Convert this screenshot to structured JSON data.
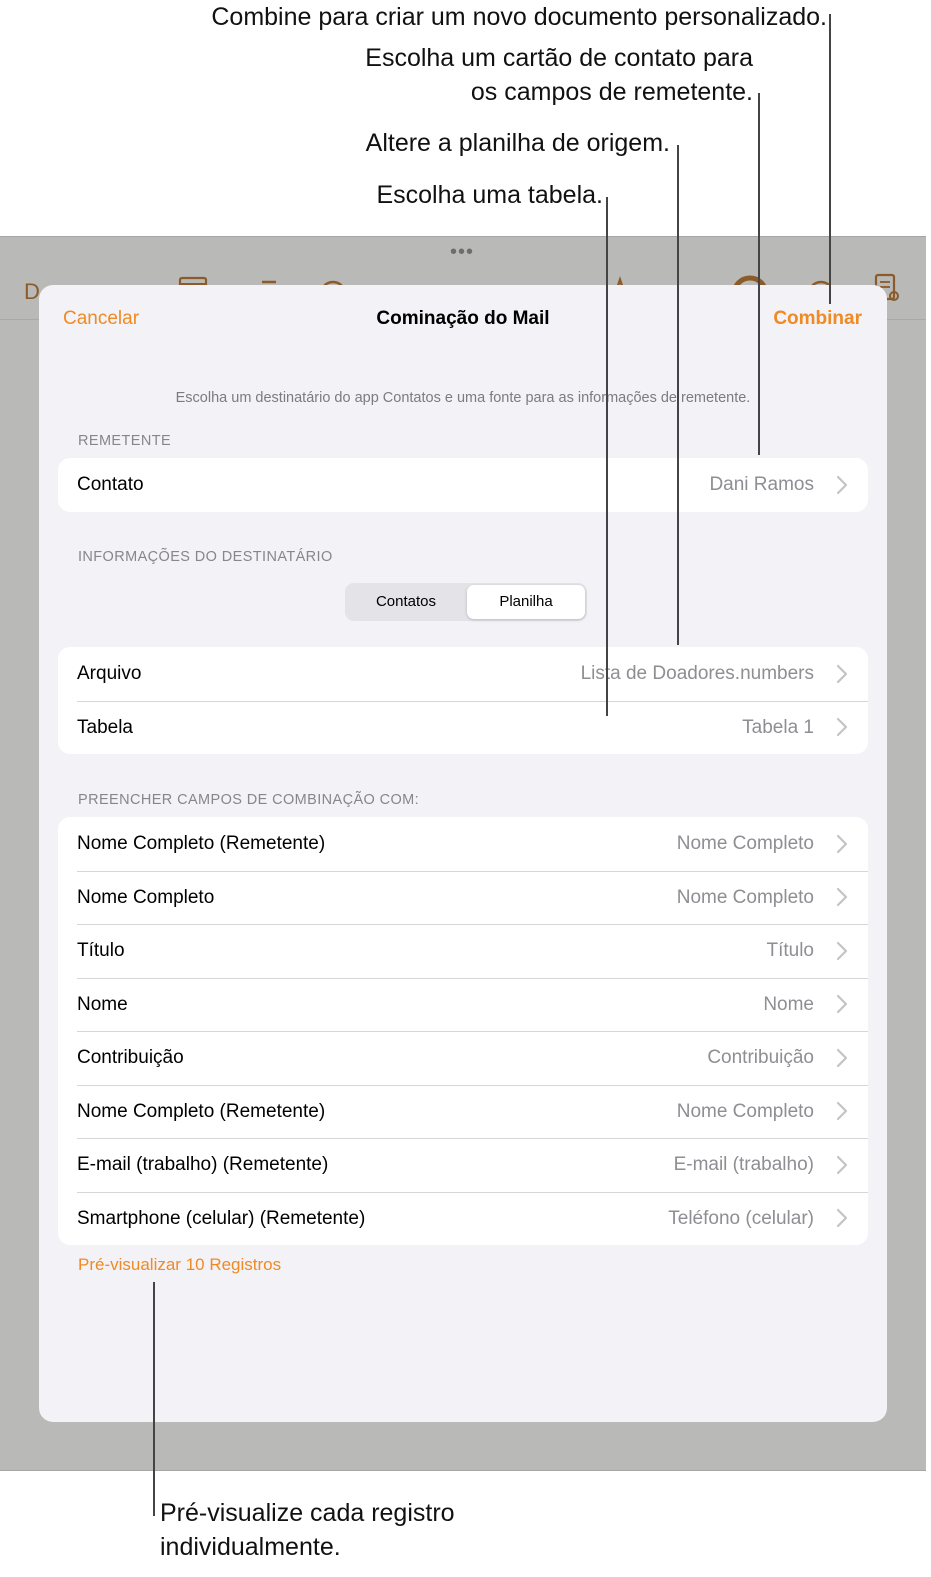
{
  "callouts": {
    "combine": "Combine para criar um novo documento personalizado.",
    "contact_line1": "Escolha um cartão de contato para",
    "contact_line2": "os campos de remetente.",
    "source": "Altere a planilha de origem.",
    "table": "Escolha uma tabela.",
    "preview_line1": "Pré-visualize cada registro",
    "preview_line2": "individualmente."
  },
  "toolbar_peek": {
    "partial_label": "D"
  },
  "sheet": {
    "cancel_label": "Cancelar",
    "title": "Cominação do Mail",
    "combine_label": "Combinar",
    "intro": "Escolha um destinatário do app Contatos e uma fonte para as informações de remetente."
  },
  "sender": {
    "header": "REMETENTE",
    "rows": [
      {
        "label": "Contato",
        "value": "Dani Ramos"
      }
    ]
  },
  "recipient": {
    "header": "INFORMAÇÕES DO DESTINATÁRIO",
    "segments": [
      "Contatos",
      "Planilha"
    ],
    "selected_segment": "Planilha",
    "rows": [
      {
        "label": "Arquivo",
        "value": "Lista de Doadores.numbers"
      },
      {
        "label": "Tabela",
        "value": "Tabela 1"
      }
    ]
  },
  "fields": {
    "header": "PREENCHER CAMPOS DE COMBINAÇÃO COM:",
    "rows": [
      {
        "label": "Nome Completo (Remetente)",
        "value": "Nome Completo"
      },
      {
        "label": "Nome Completo",
        "value": "Nome Completo"
      },
      {
        "label": "Título",
        "value": "Título"
      },
      {
        "label": "Nome",
        "value": "Nome"
      },
      {
        "label": "Contribuição",
        "value": "Contribuição"
      },
      {
        "label": "Nome Completo (Remetente)",
        "value": "Nome Completo"
      },
      {
        "label": "E-mail (trabalho) (Remetente)",
        "value": "E-mail (trabalho)"
      },
      {
        "label": "Smartphone (celular) (Remetente)",
        "value": "Teléfono (celular)"
      }
    ]
  },
  "preview_link": "Pré-visualizar 10 Registros",
  "colors": {
    "accent": "#f08a24",
    "backdrop": "#b9b9b7",
    "sheet": "#f2f2f7"
  }
}
